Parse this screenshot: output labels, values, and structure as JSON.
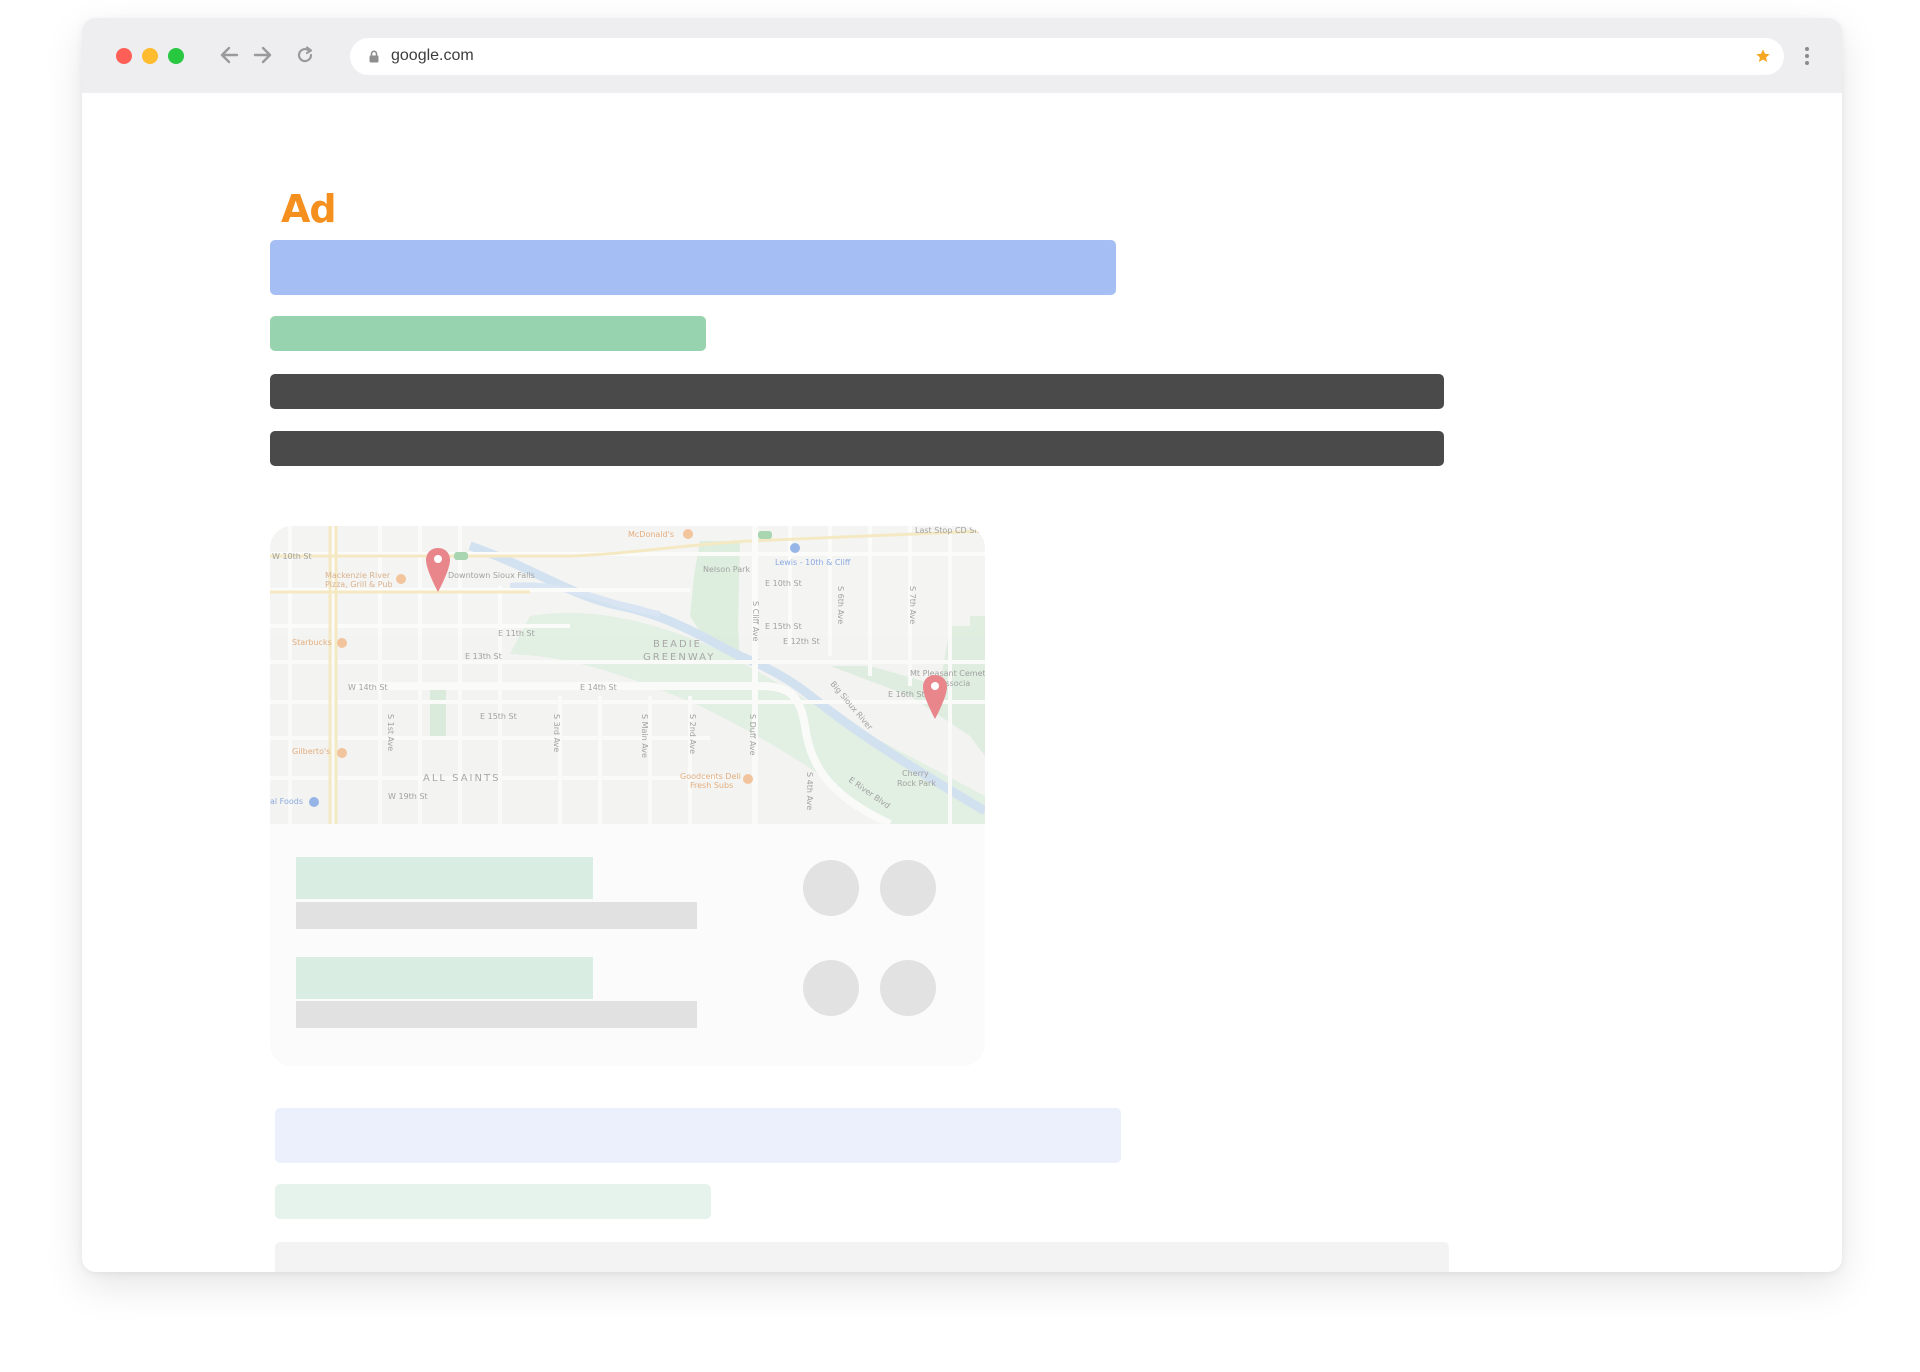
{
  "browser": {
    "url": "google.com",
    "traffic_colors": {
      "close": "#fe5f57",
      "minimize": "#febc2e",
      "maximize": "#28c840"
    },
    "icons": [
      "back-arrow-icon",
      "forward-arrow-icon",
      "reload-icon",
      "lock-icon",
      "star-icon",
      "menu-dots-icon"
    ],
    "star_color": "#f5a623"
  },
  "ad": {
    "label": "Ad",
    "label_color": "#f5901e",
    "title_bar_color": "#a5bff5",
    "url_bar_color": "#98d3b0",
    "description_bar_color": "#4a4a4a"
  },
  "map": {
    "street_labels": [
      "W 10th St",
      "E 11th St",
      "E 13th St",
      "W 14th St",
      "E 14th St",
      "E 15th St",
      "W 19th St",
      "E 10th St",
      "E 12th St",
      "E 16th St",
      "E 15th St",
      "S 1st Ave",
      "S 3rd Ave",
      "S Main Ave",
      "S 2nd Ave",
      "S Duff Ave",
      "S 4th Ave",
      "S Cliff Ave",
      "S 6th Ave",
      "S 7th Ave",
      "E River Blvd",
      "Big Sioux River",
      "S Cliff Ave"
    ],
    "area_labels": [
      "BEADIE GREENWAY",
      "ALL SAINTS",
      "Nelson Park",
      "Cherry Rock Park",
      "Mt Pleasant Cemetery Association"
    ],
    "poi_labels": [
      "McDonald's",
      "Last Stop CD Shop",
      "Lewis - 10th & Cliff",
      "Mackenzie River Pizza, Grill & Pub",
      "Downtown Sioux Falls",
      "Starbucks",
      "Gilberto's",
      "Goodcents Deli Fresh Subs",
      "Whole Foods"
    ],
    "pin_color": "#e8868b"
  },
  "listings": {
    "name_bar_color": "#d9ede2",
    "detail_bar_color": "#e1e1e1",
    "button_color": "#e2e2e2"
  },
  "organic": {
    "title_bar_color": "#ebf0fc",
    "url_bar_color": "#e6f3ec",
    "description_bar_color": "#f3f3f4"
  }
}
